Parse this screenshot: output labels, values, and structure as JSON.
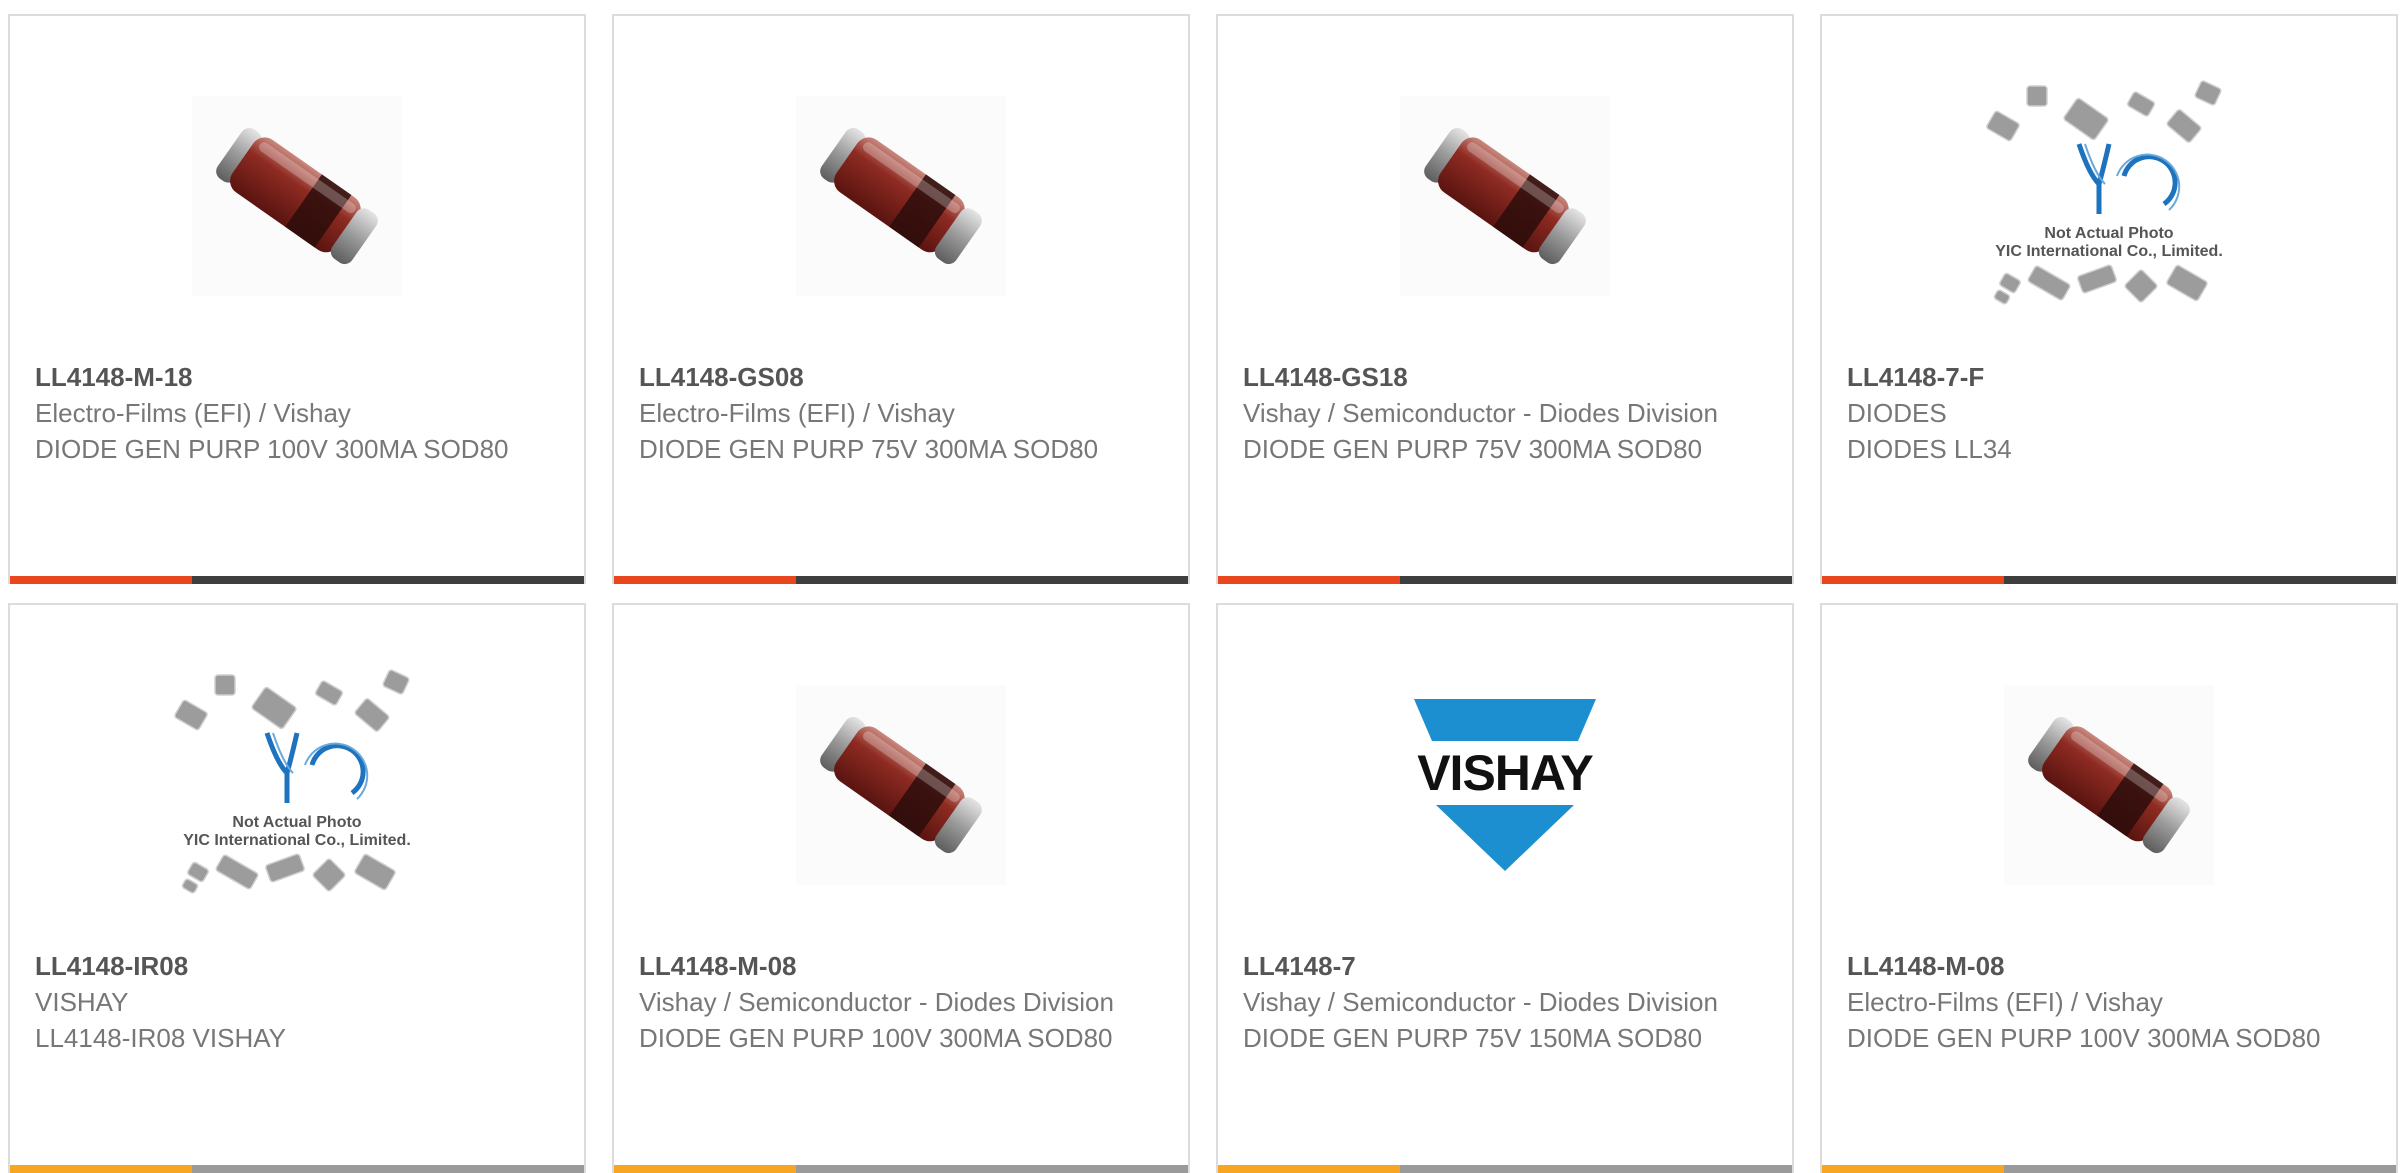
{
  "colors": {
    "accent": "#e8461e",
    "bar": "#3e3e3e",
    "border": "#dcdcdc",
    "text": "#777777"
  },
  "products": [
    {
      "part": "LL4148-M-18",
      "maker": "Electro-Films (EFI) / Vishay",
      "desc": "DIODE GEN PURP 100V 300MA SOD80",
      "image": "diode"
    },
    {
      "part": "LL4148-GS08",
      "maker": "Electro-Films (EFI) / Vishay",
      "desc": "DIODE GEN PURP 75V 300MA SOD80",
      "image": "diode"
    },
    {
      "part": "LL4148-GS18",
      "maker": "Vishay / Semiconductor - Diodes Division",
      "desc": "DIODE GEN PURP 75V 300MA SOD80",
      "image": "diode"
    },
    {
      "part": "LL4148-7-F",
      "maker": "DIODES",
      "desc": "DIODES LL34",
      "image": "yic",
      "image_text": [
        "Not Actual Photo",
        "YIC International Co., Limited."
      ]
    },
    {
      "part": "LL4148-IR08",
      "maker": "VISHAY",
      "desc": "LL4148-IR08 VISHAY",
      "image": "yic",
      "image_text": [
        "Not Actual Photo",
        "YIC International Co., Limited."
      ]
    },
    {
      "part": "LL4148-M-08",
      "maker": "Vishay / Semiconductor - Diodes Division",
      "desc": "DIODE GEN PURP 100V 300MA SOD80",
      "image": "diode"
    },
    {
      "part": "LL4148-7",
      "maker": "Vishay / Semiconductor - Diodes Division",
      "desc": "DIODE GEN PURP 75V 150MA SOD80",
      "image": "vishay",
      "image_text": [
        "VISHAY"
      ]
    },
    {
      "part": "LL4148-M-08",
      "maker": "Electro-Films (EFI) / Vishay",
      "desc": "DIODE GEN PURP 100V 300MA SOD80",
      "image": "diode"
    }
  ]
}
